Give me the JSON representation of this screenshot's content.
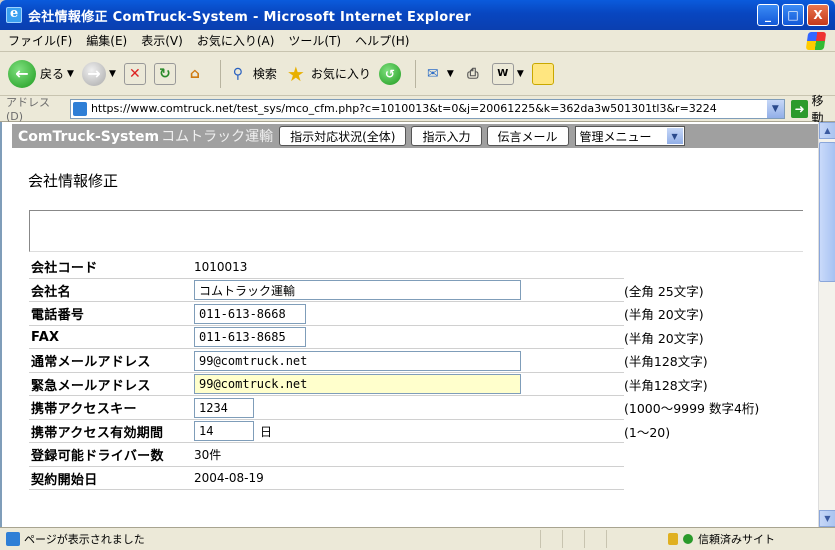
{
  "window": {
    "title": "会社情報修正 ComTruck-System - Microsoft Internet Explorer",
    "buttons": [
      "_",
      "□",
      "X"
    ]
  },
  "menu": [
    "ファイル(F)",
    "編集(E)",
    "表示(V)",
    "お気に入り(A)",
    "ツール(T)",
    "ヘルプ(H)"
  ],
  "toolbar": {
    "back_label": "戻る",
    "search_label": "検索",
    "favorites_label": "お気に入り"
  },
  "address": {
    "label": "アドレス(D)",
    "url": "https://www.comtruck.net/test_sys/mco_cfm.php?c=1010013&t=0&j=20061225&k=362da3w501301tl3&r=3224",
    "go_label": "移動"
  },
  "site": {
    "brand": "ComTruck-System",
    "brand_jp": "コムトラック運輸",
    "nav": [
      "指示対応状況(全体)",
      "指示入力",
      "伝言メール"
    ],
    "admin_menu": "管理メニュー"
  },
  "page": {
    "title": "会社情報修正"
  },
  "form": {
    "company_code": {
      "label": "会社コード",
      "value": "1010013"
    },
    "company_name": {
      "label": "会社名",
      "value": "コムトラック運輸",
      "note": "(全角 25文字)"
    },
    "phone": {
      "label": "電話番号",
      "value": "011-613-8668",
      "note": "(半角 20文字)"
    },
    "fax": {
      "label": "FAX",
      "value": "011-613-8685",
      "note": "(半角 20文字)"
    },
    "mail": {
      "label": "通常メールアドレス",
      "value": "99@comtruck.net",
      "note": "(半角128文字)"
    },
    "emergency_mail": {
      "label": "緊急メールアドレス",
      "value": "99@comtruck.net",
      "note": "(半角128文字)"
    },
    "mobile_key": {
      "label": "携帯アクセスキー",
      "value": "1234",
      "note": "(1000～9999 数字4桁)"
    },
    "mobile_period": {
      "label": "携帯アクセス有効期間",
      "value": "14",
      "unit": "日",
      "note": "(1～20)"
    },
    "drivers": {
      "label": "登録可能ドライバー数",
      "value": "30件"
    },
    "contract_start": {
      "label": "契約開始日",
      "value": "2004-08-19"
    }
  },
  "status": {
    "text": "ページが表示されました",
    "zone": "信頼済みサイト"
  }
}
